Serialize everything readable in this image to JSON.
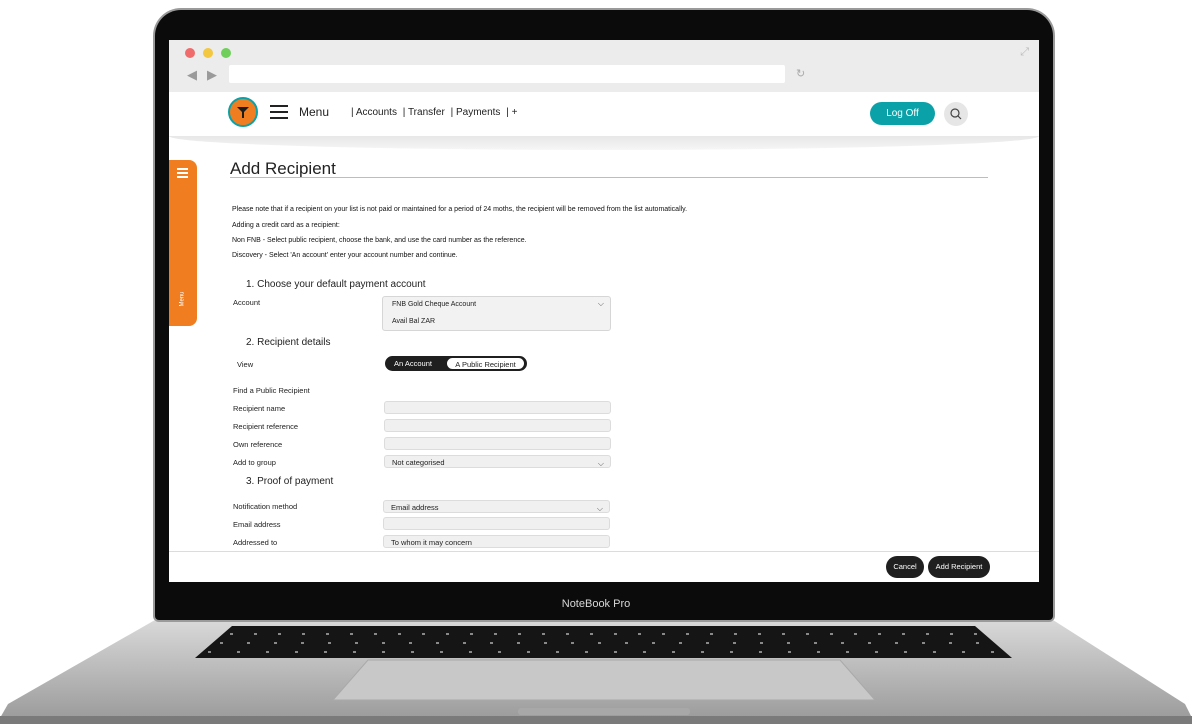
{
  "device": {
    "brand_label": "NoteBook Pro"
  },
  "app_header": {
    "menu_label": "Menu",
    "nav_items": [
      "| Accounts",
      "| Transfer",
      "| Payments",
      "| +"
    ],
    "logoff_label": "Log Off"
  },
  "side_tab": {
    "label": "Menu"
  },
  "page": {
    "title": "Add Recipient",
    "notes": [
      "Please note that if a recipient on your list is not paid or maintained for a period of 24 moths, the recipient will be removed from the list automatically.",
      "Adding a credit card as a recipient:",
      "Non FNB - Select public recipient, choose the bank, and use the card number as the reference.",
      "Discovery - Select 'An account' enter your account number and continue."
    ],
    "section1": {
      "heading": "1. Choose your default payment account",
      "account_label": "Account",
      "account_value": "FNB Gold Cheque Account",
      "account_balance": "Avail Bal ZAR"
    },
    "section2": {
      "heading": "2. Recipient details",
      "view_label": "View",
      "toggle_options": [
        "An Account",
        "A Public Recipient"
      ],
      "toggle_selected": "A Public Recipient",
      "find_label": "Find a Public Recipient",
      "recipient_name_label": "Recipient name",
      "recipient_name_value": "",
      "recipient_reference_label": "Recipient reference",
      "recipient_reference_value": "",
      "own_reference_label": "Own reference",
      "own_reference_value": "",
      "add_to_group_label": "Add to group",
      "add_to_group_value": "Not categorised"
    },
    "section3": {
      "heading": "3. Proof of payment",
      "notification_method_label": "Notification method",
      "notification_method_value": "Email address",
      "email_address_label": "Email address",
      "email_address_value": "",
      "addressed_to_label": "Addressed to",
      "addressed_to_value": "To whom it may concern"
    },
    "actions": {
      "cancel_label": "Cancel",
      "add_label": "Add Recipient"
    }
  },
  "colors": {
    "brand_orange": "#f07d1f",
    "brand_teal": "#0aa2a8",
    "dark_button": "#1f1f1f"
  }
}
